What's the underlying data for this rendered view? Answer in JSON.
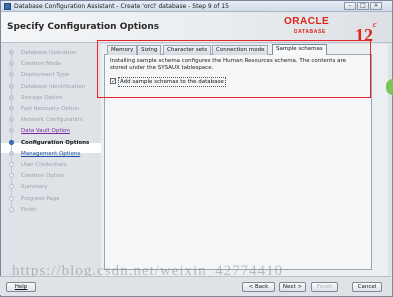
{
  "window": {
    "title": "Database Configuration Assistant - Create 'orcl' database - Step 9 of 15"
  },
  "header": {
    "title": "Specify Configuration Options",
    "brand": "ORACLE",
    "brand_sub": "DATABASE",
    "version": "12",
    "version_sup": "c"
  },
  "sidebar": {
    "steps": [
      {
        "label": "Database Operation",
        "state": "done"
      },
      {
        "label": "Creation Mode",
        "state": "done"
      },
      {
        "label": "Deployment Type",
        "state": "done"
      },
      {
        "label": "Database Identification",
        "state": "done"
      },
      {
        "label": "Storage Option",
        "state": "done"
      },
      {
        "label": "Fast Recovery Option",
        "state": "done"
      },
      {
        "label": "Network Configuration",
        "state": "done"
      },
      {
        "label": "Data Vault Option",
        "state": "link"
      },
      {
        "label": "Configuration Options",
        "state": "current"
      },
      {
        "label": "Management Options",
        "state": "linkblue"
      },
      {
        "label": "User Credentials",
        "state": "pending"
      },
      {
        "label": "Creation Option",
        "state": "pending"
      },
      {
        "label": "Summary",
        "state": "pending"
      },
      {
        "label": "Progress Page",
        "state": "pending"
      },
      {
        "label": "Finish",
        "state": "pending"
      }
    ]
  },
  "tabs": [
    {
      "label": "Memory",
      "active": false
    },
    {
      "label": "Sizing",
      "active": false
    },
    {
      "label": "Character sets",
      "active": false
    },
    {
      "label": "Connection mode",
      "active": false
    },
    {
      "label": "Sample schemas",
      "active": true
    }
  ],
  "panel": {
    "description": "Installing sample schema configures the Human Resources schema. The contents are stored under the SYSAUX tablespace.",
    "checkbox_label": "Add sample schemas to the database",
    "checkbox_checked": true
  },
  "footer": {
    "help": "Help",
    "back": "< Back",
    "next": "Next >",
    "finish": "Finish",
    "cancel": "Cancel"
  },
  "watermark": "https://blog.csdn.net/weixin_42774410",
  "colors": {
    "accent": "#e2231a",
    "highlight": "#e8242a",
    "current_step": "#3b7bc9"
  }
}
